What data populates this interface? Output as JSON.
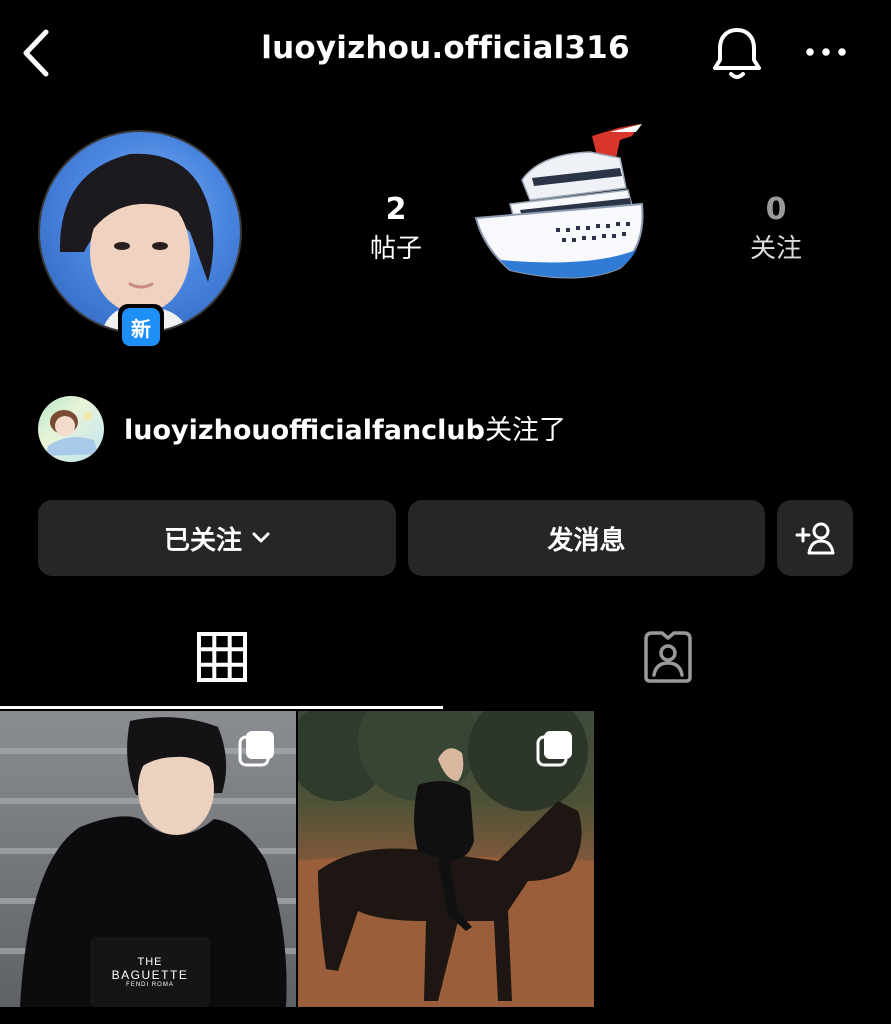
{
  "header": {
    "username": "luoyizhou.official316",
    "back_icon": "chevron-left-icon",
    "bell_icon": "bell-icon",
    "more_icon": "more-horizontal-icon"
  },
  "profile": {
    "new_badge": "新",
    "posts_count": "2",
    "posts_label": "帖子",
    "following_count": "0",
    "following_label": "关注",
    "sticker": "cruise-ship-emoji"
  },
  "followed_by": {
    "account": "luoyizhouofficialfanclub",
    "suffix": "关注了"
  },
  "actions": {
    "following_label": "已关注",
    "message_label": "发消息",
    "add_user_icon": "add-person-icon"
  },
  "tabs": {
    "grid_icon": "grid-icon",
    "tagged_icon": "tagged-person-icon"
  },
  "posts": [
    {
      "caption_line1": "THE",
      "caption_line2": "BAGUETTE",
      "caption_line3": "FENDI ROMA"
    },
    {
      "caption_line1": ""
    }
  ],
  "colors": {
    "background": "#000000",
    "button": "#262626",
    "badge_blue": "#1e8ff7"
  }
}
